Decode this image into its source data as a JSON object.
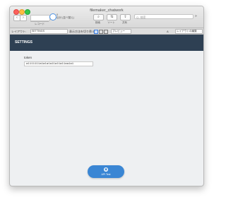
{
  "window": {
    "title": "filemaker_chatwork"
  },
  "toolbar": {
    "back": "‹",
    "forward": "›",
    "record_label": "レコード",
    "spinner_text": "0",
    "records_info": "合計 (並べ替え)",
    "search_label": "検索",
    "sort_label": "ソート",
    "share_label": "共有",
    "search_placeholder": "Q- 検索",
    "overflow": "»"
  },
  "layoutbar": {
    "layout_label": "レイアウト:",
    "layout_value": "SETTINGS",
    "view_label": "表示方法を切り替え:",
    "preview_label": "プレビュー",
    "aa_label": "A",
    "edit_layout_label": "レイアウトの編集"
  },
  "header": {
    "title": "SETTINGS"
  },
  "form": {
    "token_label": "token",
    "token_value": "a1111111a1a1a1a11a11a11aa1a1"
  },
  "api_button": {
    "label": "API Test"
  }
}
